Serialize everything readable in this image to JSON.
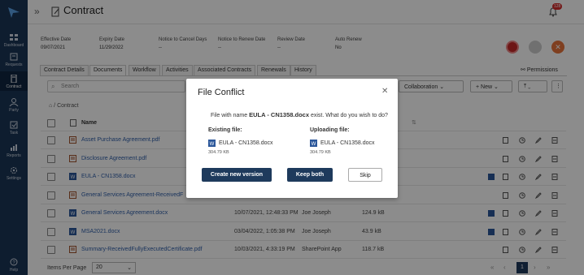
{
  "header": {
    "title": "Contract",
    "notification_count": "128"
  },
  "sidebar": {
    "items": [
      {
        "label": "Dashboard",
        "icon": "dashboard-icon"
      },
      {
        "label": "Requests",
        "icon": "requests-icon"
      },
      {
        "label": "Contract",
        "icon": "contract-icon"
      },
      {
        "label": "Party",
        "icon": "party-icon"
      },
      {
        "label": "Task",
        "icon": "task-icon"
      },
      {
        "label": "Reports",
        "icon": "reports-icon"
      },
      {
        "label": "Settings",
        "icon": "gear-icon"
      }
    ],
    "help": "Help"
  },
  "meta": [
    {
      "label": "Effective Date",
      "value": "09/07/2021"
    },
    {
      "label": "Expiry Date",
      "value": "11/29/2022"
    },
    {
      "label": "Notice to Cancel Days",
      "value": "--"
    },
    {
      "label": "Notice to Renew Date",
      "value": "--"
    },
    {
      "label": "Review Date",
      "value": "--"
    },
    {
      "label": "Auto Renew",
      "value": "No"
    }
  ],
  "tabs": [
    "Contract Details",
    "Documents",
    "Workflow",
    "Activities",
    "Associated Contracts",
    "Renewals",
    "History"
  ],
  "permissions": "Permissions",
  "toolbar": {
    "search_placeholder": "Search",
    "collaboration": "Collaboration",
    "new": "New"
  },
  "breadcrumb": "Contract",
  "table": {
    "header": "Name",
    "rows": [
      {
        "name": "Asset Purchase Agreement.pdf",
        "type": "pdf",
        "modified": "",
        "by": "",
        "size": ""
      },
      {
        "name": "Disclosure Agreement.pdf",
        "type": "pdf",
        "modified": "",
        "by": "",
        "size": ""
      },
      {
        "name": "EULA - CN1358.docx",
        "type": "docx",
        "modified": "",
        "by": "",
        "size": ""
      },
      {
        "name": "General Services Agreement-ReceivedF",
        "type": "pdf",
        "modified": "",
        "by": "",
        "size": ""
      },
      {
        "name": "General Services Agreement.docx",
        "type": "docx",
        "modified": "10/07/2021, 12:48:33 PM",
        "by": "Joe Joseph",
        "size": "124.9 kB"
      },
      {
        "name": "MSA2021.docx",
        "type": "docx",
        "modified": "03/04/2022, 1:05:38 PM",
        "by": "Joe Joseph",
        "size": "43.9 kB"
      },
      {
        "name": "Summary-ReceivedFullyExecutedCertificate.pdf",
        "type": "pdf",
        "modified": "10/03/2021, 4:33:19 PM",
        "by": "SharePoint App",
        "size": "118.7 kB"
      }
    ]
  },
  "footer": {
    "items_per_page_label": "Items Per Page",
    "items_per_page": "20",
    "current_page": "1"
  },
  "modal": {
    "title": "File Conflict",
    "msg_prefix": "File with name",
    "filename": "EULA - CN1358.docx",
    "msg_suffix": "exist. What do you wish to do?",
    "existing_label": "Existing file:",
    "uploading_label": "Uploading file:",
    "existing_name": "EULA - CN1358.docx",
    "existing_size": "304.79 KB",
    "uploading_name": "EULA - CN1358.docx",
    "uploading_size": "304.79 KB",
    "btn_new_version": "Create new version",
    "btn_keep_both": "Keep both",
    "btn_skip": "Skip"
  },
  "colors": {
    "sidebar": "#1b3556",
    "accent_dark": "#1e3a5c",
    "link": "#2f5ea8",
    "red": "#c62828",
    "orange": "#e8743b"
  }
}
